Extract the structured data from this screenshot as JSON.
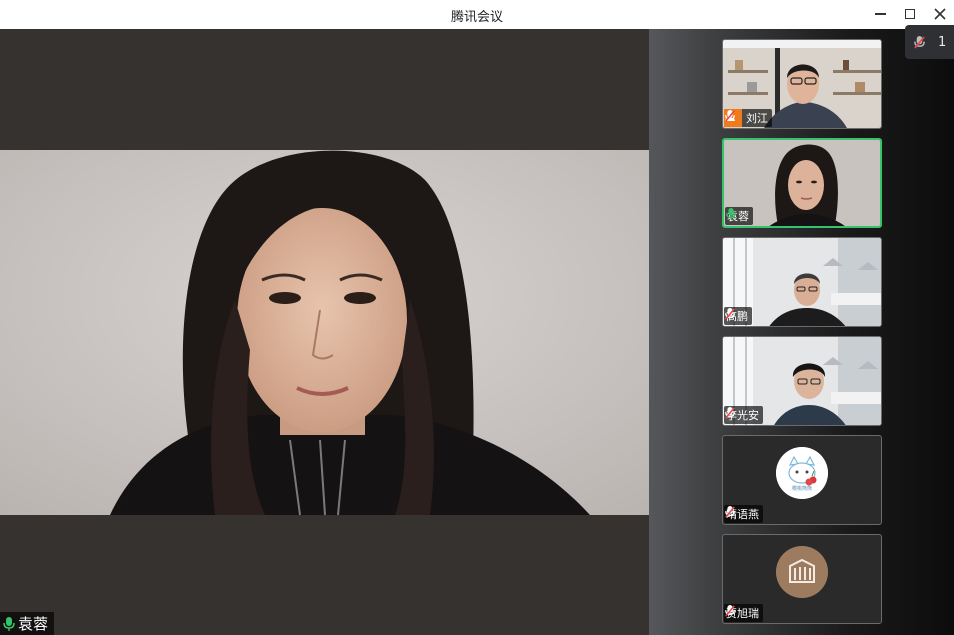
{
  "window": {
    "title": "腾讯会议"
  },
  "main_speaker": {
    "name": "袁蓉",
    "mic": "on"
  },
  "floating_bar": {
    "text_fragment": "1"
  },
  "participants": [
    {
      "name": "刘江",
      "mic": "muted",
      "host": true,
      "view": "video",
      "active": false
    },
    {
      "name": "袁蓉",
      "mic": "on",
      "host": false,
      "view": "video",
      "active": true
    },
    {
      "name": "高鹏",
      "mic": "muted",
      "host": false,
      "view": "video",
      "active": false
    },
    {
      "name": "李光安",
      "mic": "muted",
      "host": false,
      "view": "video",
      "active": false
    },
    {
      "name": "晴语燕",
      "mic": "muted",
      "host": false,
      "view": "avatar",
      "active": false,
      "avatar_text": "樱桃熊熊"
    },
    {
      "name": "贾旭瑞",
      "mic": "muted",
      "host": false,
      "view": "avatar",
      "active": false
    }
  ],
  "colors": {
    "active_border": "#35c46a",
    "mic_on": "#35c46a",
    "mic_muted": "#e5484d",
    "host_badge": "#f07b1d"
  }
}
